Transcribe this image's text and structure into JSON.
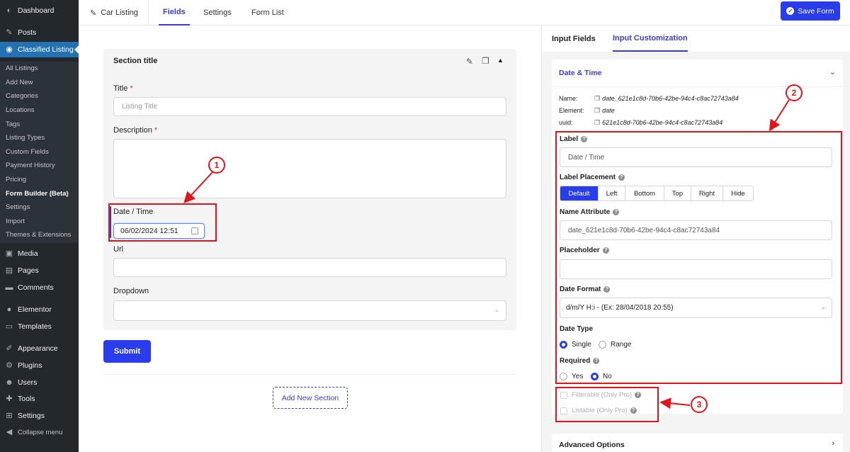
{
  "sidebar": {
    "items": [
      {
        "label": "Dashboard",
        "icon": "dashboard-icon"
      },
      {
        "label": "Posts",
        "icon": "pin-icon"
      },
      {
        "label": "Classified Listing",
        "icon": "location-icon"
      },
      {
        "label": "Media",
        "icon": "media-icon"
      },
      {
        "label": "Pages",
        "icon": "pages-icon"
      },
      {
        "label": "Comments",
        "icon": "comments-icon"
      },
      {
        "label": "Elementor",
        "icon": "elementor-icon"
      },
      {
        "label": "Templates",
        "icon": "folder-icon"
      },
      {
        "label": "Appearance",
        "icon": "brush-icon"
      },
      {
        "label": "Plugins",
        "icon": "plugin-icon"
      },
      {
        "label": "Users",
        "icon": "users-icon"
      },
      {
        "label": "Tools",
        "icon": "wrench-icon"
      },
      {
        "label": "Settings",
        "icon": "settings-icon"
      },
      {
        "label": "Collapse menu",
        "icon": "collapse-icon"
      }
    ],
    "submenu": [
      "All Listings",
      "Add New",
      "Categories",
      "Locations",
      "Tags",
      "Listing Types",
      "Custom Fields",
      "Payment History",
      "Pricing",
      "Form Builder (Beta)",
      "Settings",
      "Import",
      "Themes & Extensions"
    ]
  },
  "topbar": {
    "title": "Car Listing",
    "tabs": [
      "Fields",
      "Settings",
      "Form List"
    ],
    "save_label": "Save Form"
  },
  "builder": {
    "section_title": "Section title",
    "fields": {
      "title_label": "Title",
      "title_placeholder": "Listing Title",
      "description_label": "Description",
      "date_label": "Date / Time",
      "date_value": "06/02/2024 12:51",
      "url_label": "Url",
      "dropdown_label": "Dropdown"
    },
    "required_mark": "*",
    "submit_label": "Submit",
    "add_section_label": "Add New Section"
  },
  "panel": {
    "tabs": [
      "Input Fields",
      "Input Customization"
    ],
    "card_title": "Date & Time",
    "meta": {
      "name_key": "Name:",
      "name_value": "date_621e1c8d-70b6-42be-94c4-c8ac72743a84",
      "element_key": "Element:",
      "element_value": "date",
      "uuid_key": "uuid:",
      "uuid_value": "621e1c8d-70b6-42be-94c4-c8ac72743a84"
    },
    "label_label": "Label",
    "label_value": "Date / Time",
    "placement_label": "Label Placement",
    "placement_options": [
      "Default",
      "Left",
      "Bottom",
      "Top",
      "Right",
      "Hide"
    ],
    "placement_selected": "Default",
    "name_attr_label": "Name Attribute",
    "name_attr_value": "date_621e1c8d-70b6-42be-94c4-c8ac72743a84",
    "placeholder_label": "Placeholder",
    "placeholder_value": "",
    "date_format_label": "Date Format",
    "date_format_value": "d/m/Y H:i - (Ex: 28/04/2018 20:55)",
    "date_type_label": "Date Type",
    "date_type_options": [
      "Single",
      "Range"
    ],
    "date_type_selected": "Single",
    "required_label": "Required",
    "required_options": [
      "Yes",
      "No"
    ],
    "required_selected": "No",
    "filterable_label": "Filterable (Only Pro)",
    "listable_label": "Listable (Only Pro)",
    "advanced_label": "Advanced Options"
  },
  "callouts": [
    "1",
    "2",
    "3"
  ],
  "colors": {
    "accent": "#2a3dec",
    "highlight": "#e3131b",
    "sidebar": "#23282d",
    "wp_active": "#2271b1"
  }
}
